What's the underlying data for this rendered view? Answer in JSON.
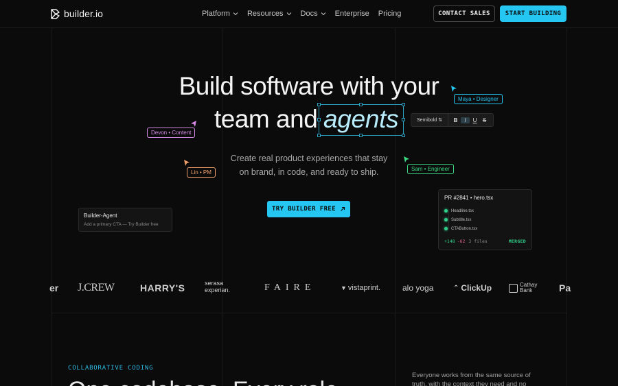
{
  "header": {
    "logo_text": "builder.io",
    "nav": [
      {
        "label": "Platform",
        "has_dropdown": true
      },
      {
        "label": "Resources",
        "has_dropdown": true
      },
      {
        "label": "Docs",
        "has_dropdown": true
      },
      {
        "label": "Enterprise",
        "has_dropdown": false
      },
      {
        "label": "Pricing",
        "has_dropdown": false
      }
    ],
    "contact_label": "CONTACT SALES",
    "start_label": "START BUILDING"
  },
  "hero": {
    "title_line1": "Build software with your",
    "title_line2_prefix": "team and",
    "title_highlight": "agents",
    "subtitle_line1": "Create real product experiences that stay",
    "subtitle_line2": "on brand, in code, and ready to ship.",
    "cta_label": "TRY BUILDER FREE",
    "cta_icon": "arrow-up-right-icon"
  },
  "collaborators": [
    {
      "label": "Maya • Designer",
      "color": "#26c6f3"
    },
    {
      "label": "Devon • Content",
      "color": "#d68ae6"
    },
    {
      "label": "Lin • PM",
      "color": "#f2a06b"
    },
    {
      "label": "Sam • Engineer",
      "color": "#3ddc84"
    }
  ],
  "toolbar": {
    "font_weight": "Semibold",
    "buttons": [
      "B",
      "I",
      "U",
      "S"
    ]
  },
  "agent_card": {
    "title": "Builder-Agent",
    "description": "Add a primary CTA — Try Builder free"
  },
  "pr_card": {
    "title": "PR #2841 • hero.tsx",
    "files": [
      "Headline.tsx",
      "Subtitle.tsx",
      "CTAButton.tsx"
    ],
    "additions": "+148",
    "deletions": "-62",
    "file_count": "3 files",
    "status": "MERGED"
  },
  "logos": [
    "er",
    "J.CREW",
    "HARRY'S",
    "serasa experian.",
    "FAIRE",
    "vistaprint.",
    "alo yoga",
    "ClickUp",
    "Cathay Bank",
    "Pa"
  ],
  "section": {
    "kicker": "COLLABORATIVE CODING",
    "heading_partial": "One codebase. Every role.",
    "side_text": "Everyone works from the same source of truth, with the context they need and no"
  }
}
